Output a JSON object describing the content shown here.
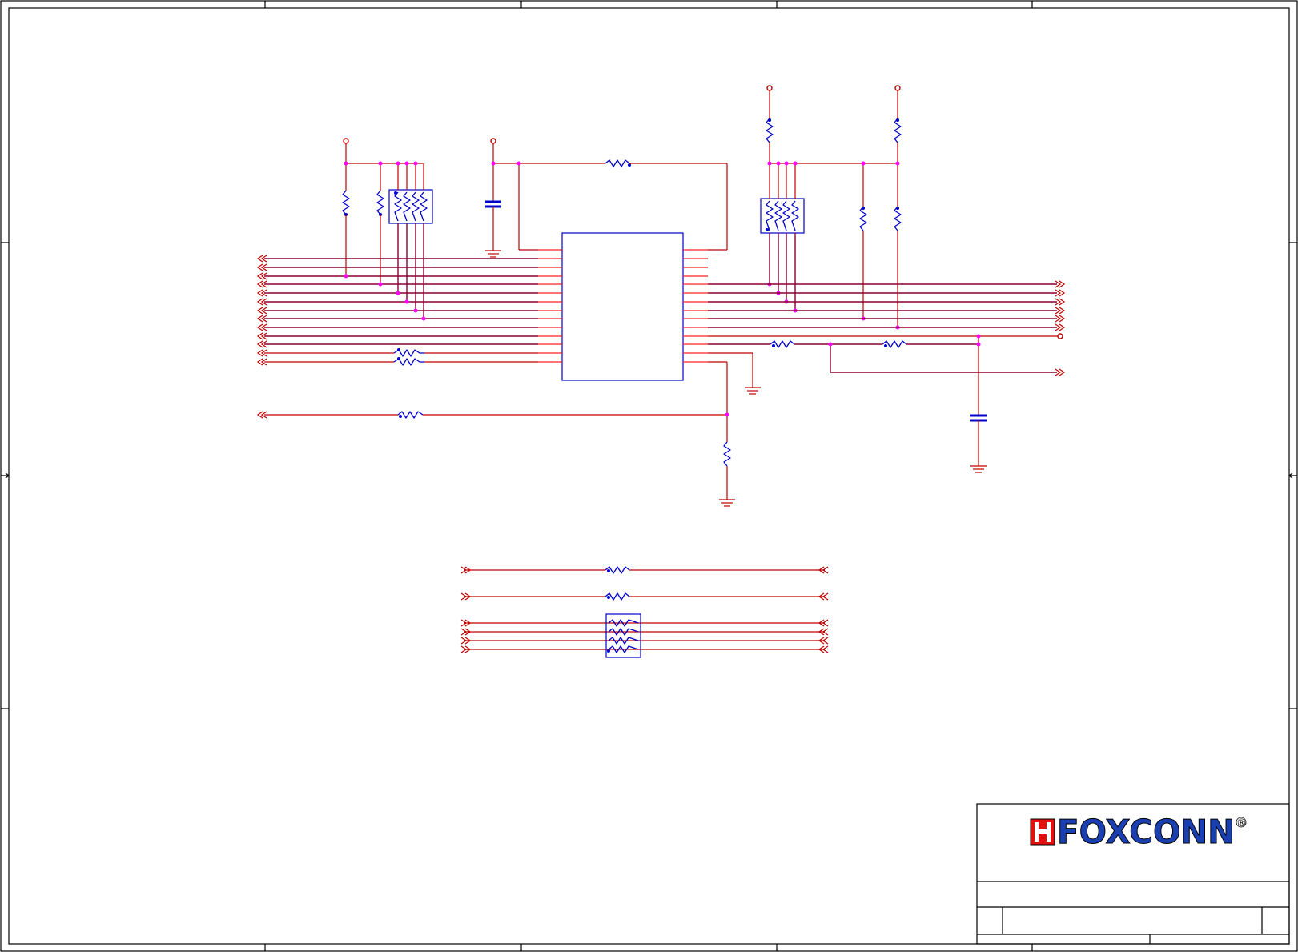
{
  "title_block": {
    "company": "FOXCONN",
    "registered_mark": "®",
    "logo_colors": {
      "primary": "#1a3fb0",
      "accent": "#e01010",
      "outline": "#000000"
    }
  },
  "colors": {
    "wire": "#c00000",
    "bus_wire": "#8b0033",
    "component": "#0000cc",
    "junction": "#ff00ff",
    "frame": "#000000"
  },
  "icons": [
    "off-page-connector-icon",
    "resistor-icon",
    "resistor-network-icon",
    "capacitor-icon",
    "ground-icon",
    "power-rail-icon",
    "junction-dot-icon"
  ]
}
